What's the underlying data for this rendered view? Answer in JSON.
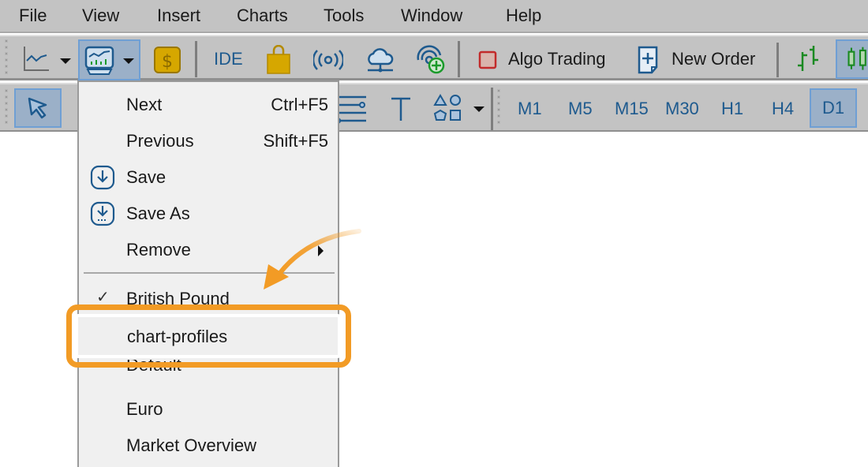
{
  "menubar": {
    "items": [
      "File",
      "View",
      "Insert",
      "Charts",
      "Tools",
      "Window",
      "Help"
    ]
  },
  "toolbar1": {
    "ide_label": "IDE",
    "algo_trading_label": "Algo Trading",
    "new_order_label": "New Order",
    "icons": [
      "line-chart-icon",
      "profiles-icon",
      "dollar-icon",
      "market-bag-icon",
      "signals-icon",
      "vps-cloud-icon",
      "add-signal-icon",
      "algo-trading-icon",
      "new-order-icon",
      "bar-chart-icon",
      "candlestick-icon"
    ]
  },
  "toolbar2": {
    "timeframes": [
      "M1",
      "M5",
      "M15",
      "M30",
      "H1",
      "H4",
      "D1"
    ],
    "active_timeframe": "D1",
    "icons": [
      "cursor-icon",
      "fibonacci-icon",
      "text-icon",
      "shapes-icon"
    ]
  },
  "dropdown": {
    "items": [
      {
        "label": "Next",
        "shortcut": "Ctrl+F5"
      },
      {
        "label": "Previous",
        "shortcut": "Shift+F5"
      },
      {
        "label": "Save",
        "icon": "save-icon"
      },
      {
        "label": "Save As",
        "icon": "save-as-icon"
      },
      {
        "label": "Remove",
        "submenu": true
      }
    ],
    "profiles": [
      {
        "label": "British Pound",
        "checked": true
      },
      {
        "label": "chart-profiles",
        "highlighted": true
      },
      {
        "label": "Default"
      },
      {
        "label": "Euro"
      },
      {
        "label": "Market Overview"
      }
    ]
  },
  "annotation": {
    "highlight_color": "#f29b25"
  }
}
